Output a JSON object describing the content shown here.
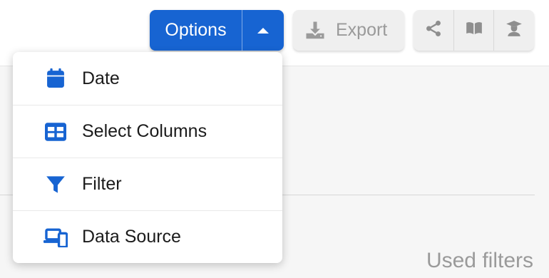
{
  "toolbar": {
    "options_label": "Options",
    "export_label": "Export",
    "accent_color": "#1764d2",
    "icons": [
      "share-icon",
      "book-icon",
      "graduation-icon"
    ]
  },
  "options_menu": {
    "items": [
      {
        "label": "Date",
        "icon": "calendar-icon"
      },
      {
        "label": "Select Columns",
        "icon": "table-columns-icon"
      },
      {
        "label": "Filter",
        "icon": "filter-icon"
      },
      {
        "label": "Data Source",
        "icon": "devices-icon"
      }
    ]
  },
  "panel": {
    "used_filters_label": "Used filters"
  }
}
